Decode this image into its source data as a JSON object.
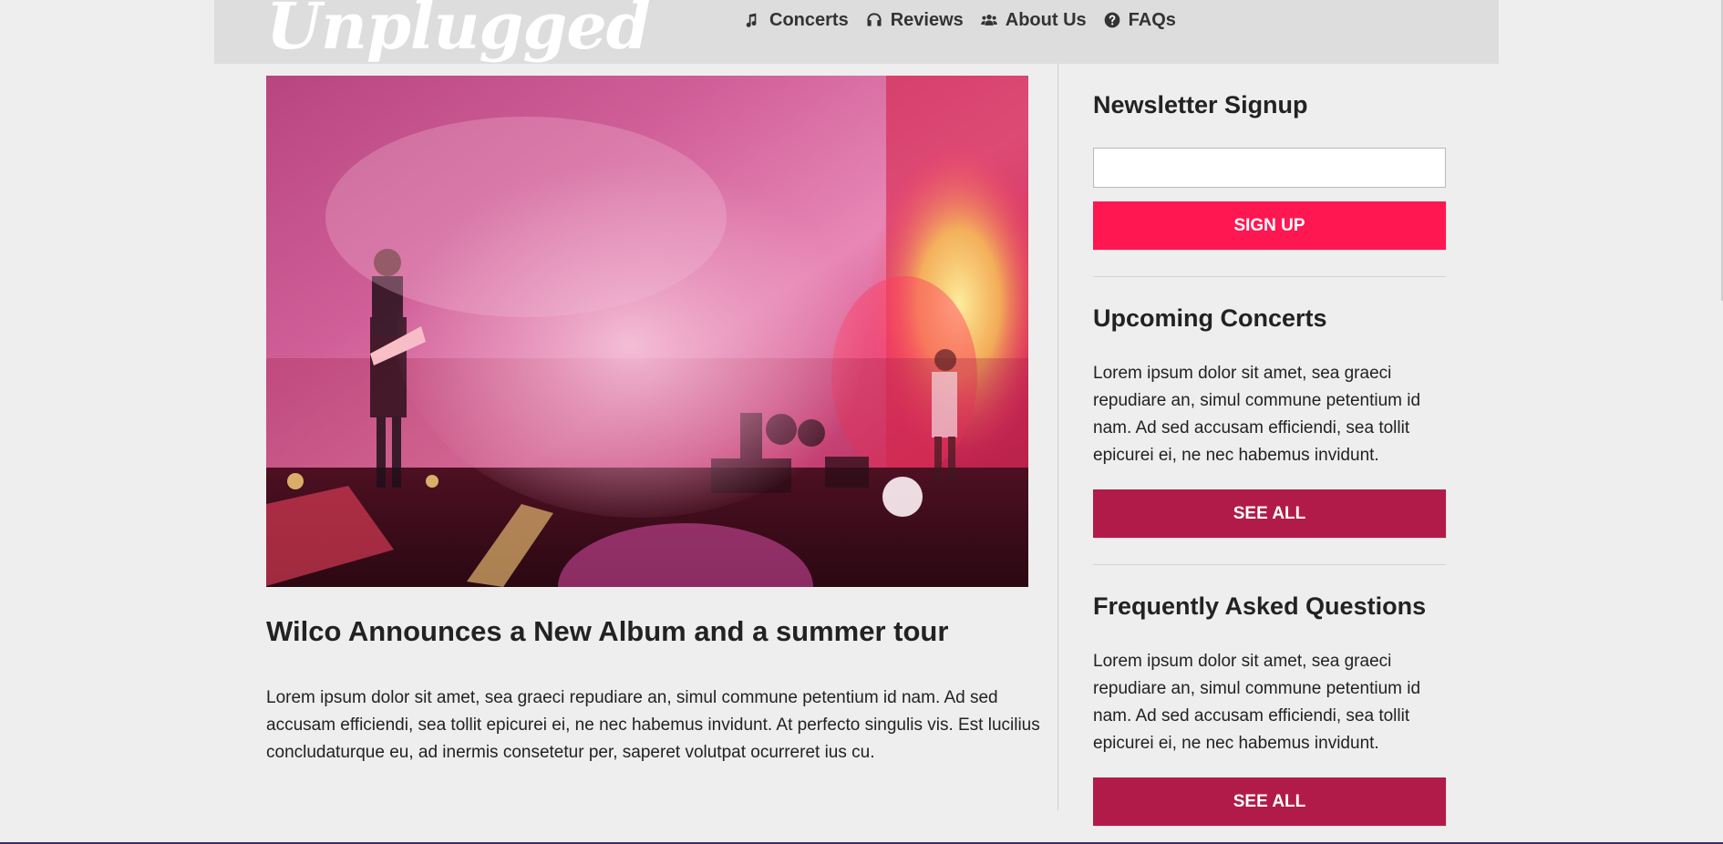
{
  "header": {
    "logo_text": "Unplugged",
    "nav": [
      {
        "label": "Concerts",
        "icon": "music-note-icon"
      },
      {
        "label": "Reviews",
        "icon": "headphones-icon"
      },
      {
        "label": "About Us",
        "icon": "users-icon"
      },
      {
        "label": "FAQs",
        "icon": "question-circle-icon"
      }
    ]
  },
  "main": {
    "hero_image": "concert-stage-photo",
    "article": {
      "title": "Wilco Announces a New Album and a summer tour",
      "body": "Lorem ipsum dolor sit amet, sea graeci repudiare an, simul commune petentium id nam. Ad sed accusam efficiendi, sea tollit epicurei ei, ne nec habemus invidunt. At perfecto singulis vis. Est lucilius concludaturque eu, ad inermis consetetur per, saperet volutpat ocurreret ius cu."
    }
  },
  "sidebar": {
    "newsletter": {
      "title": "Newsletter Signup",
      "input_value": "",
      "input_placeholder": "",
      "button_label": "Sign up"
    },
    "upcoming": {
      "title": "Upcoming Concerts",
      "text": "Lorem ipsum dolor sit amet, sea graeci repudiare an, simul commune petentium id nam. Ad sed accusam efficiendi, sea tollit epicurei ei, ne nec habemus invidunt.",
      "button_label": "See all"
    },
    "faq": {
      "title": "Frequently Asked Questions",
      "text": "Lorem ipsum dolor sit amet, sea graeci repudiare an, simul commune petentium id nam. Ad sed accusam efficiendi, sea tollit epicurei ei, ne nec habemus invidunt.",
      "button_label": "See all"
    }
  },
  "colors": {
    "page_bg": "#efeeee",
    "header_bg": "#dddddd",
    "signup_button": "#ff1752",
    "see_all_button": "#b11b4a"
  }
}
